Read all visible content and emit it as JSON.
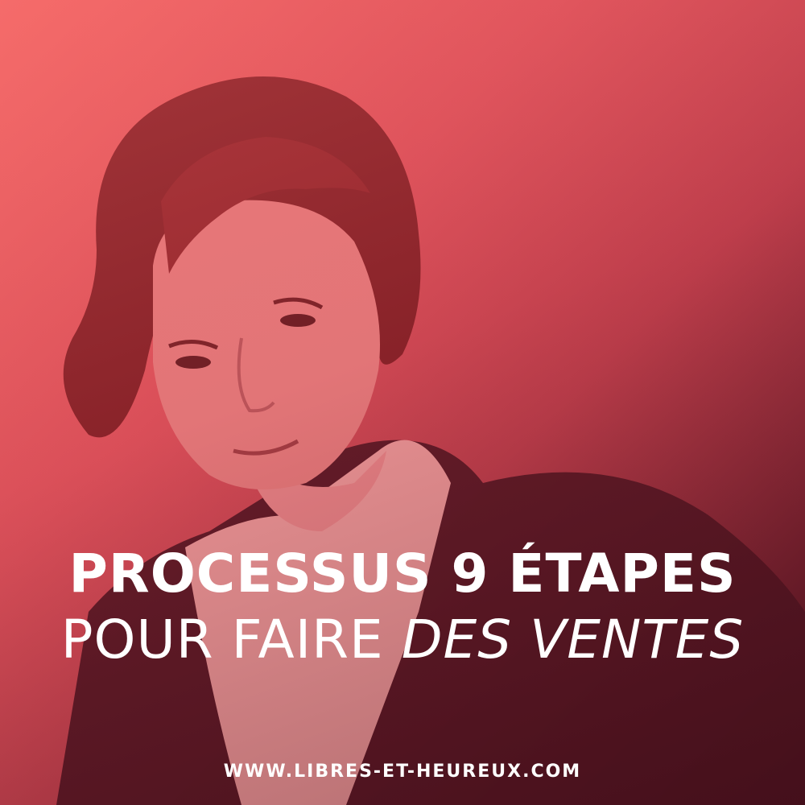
{
  "headline": {
    "line1": "PROCESSUS 9 ÉTAPES",
    "line2_regular": "POUR FAIRE ",
    "line2_italic": "DES VENTES"
  },
  "footer": {
    "url": "WWW.LIBRES-ET-HEUREUX.COM"
  },
  "colors": {
    "overlay_light": "#f06a68",
    "overlay_dark": "#3a0f18",
    "text": "#ffffff"
  }
}
